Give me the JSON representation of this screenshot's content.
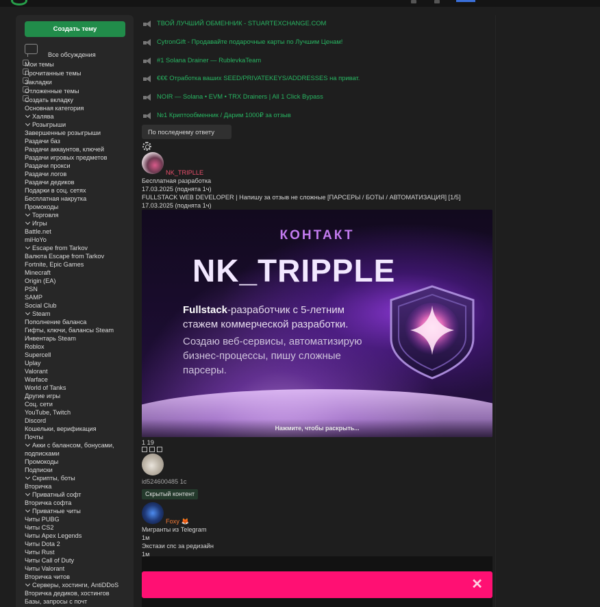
{
  "sidebar": {
    "create_button": "Создать тему",
    "nav": [
      {
        "label": "Все обсуждения"
      },
      {
        "label": "Мои темы"
      },
      {
        "label": "Прочитанные темы"
      },
      {
        "label": "Закладки"
      },
      {
        "label": "Отложенные темы"
      },
      {
        "label": "Создать вкладку"
      }
    ],
    "items": [
      {
        "label": "Основная категория",
        "chevron": false
      },
      {
        "label": "Халява",
        "chevron": true
      },
      {
        "label": "Розыгрыши",
        "chevron": true
      },
      {
        "label": "Завершенные розыгрыши",
        "chevron": false
      },
      {
        "label": "Раздачи баз",
        "chevron": false
      },
      {
        "label": "Раздачи аккаунтов, ключей",
        "chevron": false
      },
      {
        "label": "Раздачи игровых предметов",
        "chevron": false
      },
      {
        "label": "Раздачи прокси",
        "chevron": false
      },
      {
        "label": "Раздачи логов",
        "chevron": false
      },
      {
        "label": "Раздачи дедиков",
        "chevron": false
      },
      {
        "label": "Подарки в соц. сетях",
        "chevron": false
      },
      {
        "label": "Бесплатная накрутка",
        "chevron": false
      },
      {
        "label": "Промокоды",
        "chevron": false
      },
      {
        "label": "Торговля",
        "chevron": true
      },
      {
        "label": "Игры",
        "chevron": true
      },
      {
        "label": "Battle.net",
        "chevron": false
      },
      {
        "label": "miHoYo",
        "chevron": false
      },
      {
        "label": "Escape from Tarkov",
        "chevron": true
      },
      {
        "label": "Валюта Escape from Tarkov",
        "chevron": false
      },
      {
        "label": "Fortnite, Epic Games",
        "chevron": false
      },
      {
        "label": "Minecraft",
        "chevron": false
      },
      {
        "label": "Origin (EA)",
        "chevron": false
      },
      {
        "label": "PSN",
        "chevron": false
      },
      {
        "label": "SAMP",
        "chevron": false
      },
      {
        "label": "Social Club",
        "chevron": false
      },
      {
        "label": "Steam",
        "chevron": true
      },
      {
        "label": "Пополнение баланса",
        "chevron": false
      },
      {
        "label": "Гифты, ключи, балансы Steam",
        "chevron": false
      },
      {
        "label": "Инвентарь Steam",
        "chevron": false
      },
      {
        "label": "Roblox",
        "chevron": false
      },
      {
        "label": "Supercell",
        "chevron": false
      },
      {
        "label": "Uplay",
        "chevron": false
      },
      {
        "label": "Valorant",
        "chevron": false
      },
      {
        "label": "Warface",
        "chevron": false
      },
      {
        "label": "World of Tanks",
        "chevron": false
      },
      {
        "label": "Другие игры",
        "chevron": false
      },
      {
        "label": "Соц. сети",
        "chevron": false
      },
      {
        "label": "YouTube, Twitch",
        "chevron": false
      },
      {
        "label": "Discord",
        "chevron": false
      },
      {
        "label": "Кошельки, верификация",
        "chevron": false
      },
      {
        "label": "Почты",
        "chevron": false
      },
      {
        "label": "Акки с балансом, бонусами,",
        "chevron": true
      },
      {
        "label": "подписками",
        "chevron": false
      },
      {
        "label": "Промокоды",
        "chevron": false
      },
      {
        "label": "Подписки",
        "chevron": false
      },
      {
        "label": "Скрипты, боты",
        "chevron": true
      },
      {
        "label": "Вторичка",
        "chevron": false
      },
      {
        "label": "Приватный софт",
        "chevron": true
      },
      {
        "label": "Вторичка софта",
        "chevron": false
      },
      {
        "label": "Приватные читы",
        "chevron": true
      },
      {
        "label": "Читы PUBG",
        "chevron": false
      },
      {
        "label": "Читы CS2",
        "chevron": false
      },
      {
        "label": "Читы Apex Legends",
        "chevron": false
      },
      {
        "label": "Читы Dota 2",
        "chevron": false
      },
      {
        "label": "Читы Rust",
        "chevron": false
      },
      {
        "label": "Читы Call of Duty",
        "chevron": false
      },
      {
        "label": "Читы Valorant",
        "chevron": false
      },
      {
        "label": "Вторичка читов",
        "chevron": false
      },
      {
        "label": "Серверы, хостинги, AntiDDoS",
        "chevron": true
      },
      {
        "label": "Вторичка дедиков, хостингов",
        "chevron": false
      },
      {
        "label": "Базы, запросы с почт",
        "chevron": false
      }
    ]
  },
  "ads": [
    "ТВОЙ ЛУЧШИЙ ОБМЕННИК - STUARTEXCHANGE.COM",
    "CytronGift - Продавайте подарочные карты по Лучшим Ценам!",
    "#1 Solana Drainer — RublevkaTeam",
    "€€€ Отработка ваших SEED/PRIVATEKEYS/ADDRESSES на приват.",
    "NOIR — Solana • EVM • TRX Drainers | All 1 Click Bypass",
    "№1 Криптообменник / Дарим 1000₽ за отзыв"
  ],
  "sort_button": "По последнему ответу",
  "thread1": {
    "username": "NK_TRIPLLE",
    "category": "Бесплатная разработка",
    "date": "17.03.2025 (поднята 1ч)",
    "title": "FULLSTACK WEB DEVELOPER | Напишу за отзыв не сложные [ПАРСЕРЫ / БОТЫ / АВТОМАТИЗАЦИЯ] [1/5]",
    "date2": "17.03.2025 (поднята 1ч)",
    "banner": {
      "heading": "КОНТАКТ",
      "name": "NK_TRIPPLE",
      "line1_bold": "Fullstack",
      "line1_rest": "-разработчик с 5-летним стажем коммерческой разработки.",
      "line2": "Создаю веб-сервисы, автоматизирую бизнес-процессы, пишу сложные парсеры.",
      "expand": "Нажмите, чтобы раскрыть..."
    },
    "stats": "1 19"
  },
  "reply": {
    "user_id": "id524600485",
    "time": "1с",
    "badge": "Скрытый контент"
  },
  "thread2": {
    "username": "Foxy",
    "emoji": "🦊",
    "title": "Мигранты из Telegram",
    "time1": "1м",
    "subtitle": "Экстази спс за редизайн",
    "time2": "1м"
  },
  "popup": {
    "close": "✕"
  },
  "colors": {
    "accent_green": "#218c4a",
    "ad_green": "#28b562",
    "username_red": "#ea4f6c",
    "popup_pink": "#ff1073"
  }
}
